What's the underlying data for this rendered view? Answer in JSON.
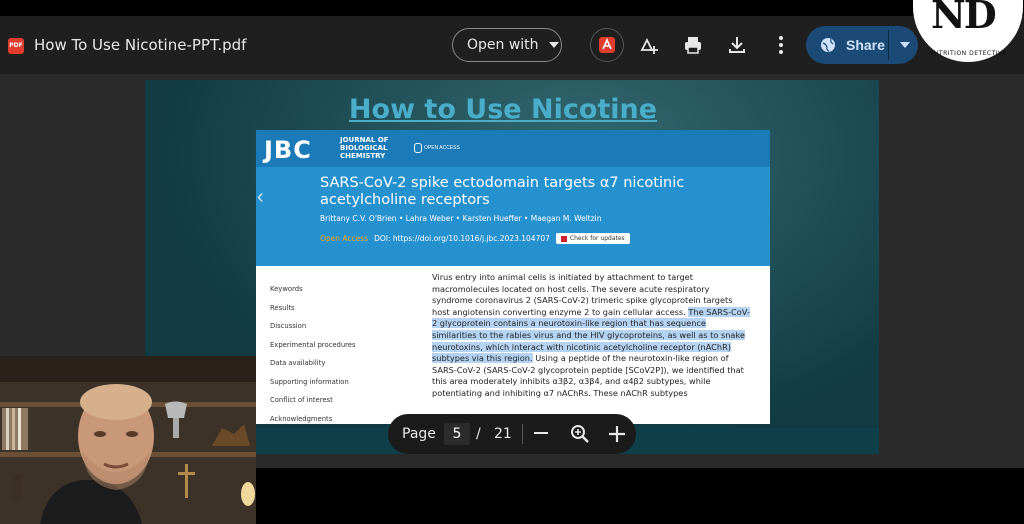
{
  "toolbar": {
    "pdf_badge": "PDF",
    "file_title": "How To Use Nicotine-PPT.pdf",
    "open_with": "Open with",
    "share": "Share"
  },
  "slide": {
    "title": "How to Use Nicotine",
    "journal": {
      "logo": "JBC",
      "name": "JOURNAL OF BIOLOGICAL CHEMISTRY",
      "open_badge": "OPEN ACCESS"
    },
    "article_title": "SARS-CoV-2 spike ectodomain targets α7 nicotinic acetylcholine receptors",
    "authors": "Brittany C.V. O'Brien • Lahra Weber • Karsten Hueffer • Maegan M. Weltzin",
    "open_access": "Open Access",
    "doi": "DOI: https://doi.org/10.1016/j.jbc.2023.104707",
    "check_updates": "Check for updates",
    "toc": [
      "Keywords",
      "Results",
      "Discussion",
      "Experimental procedures",
      "Data availability",
      "Supporting information",
      "Conflict of interest",
      "Acknowledgments"
    ],
    "abstract_pre": "Virus entry into animal cells is initiated by attachment to target macromolecules located on host cells. The severe acute respiratory syndrome coronavirus 2 (SARS-CoV-2) trimeric spike glycoprotein targets host angiotensin converting enzyme 2 to gain cellular access.",
    "abstract_hl": "The SARS-CoV-2 glycoprotein contains a neurotoxin-like region that has sequence similarities to the rabies virus and the HIV glycoproteins, as well as to snake neurotoxins, which interact with nicotinic acetylcholine receptor (nAChR) subtypes via this region.",
    "abstract_post": "Using a peptide of the neurotoxin-like region of SARS-CoV-2 (SARS-CoV-2 glycoprotein peptide [SCoV2P]), we identified that this area moderately inhibits α3β2, α3β4, and α4β2 subtypes, while potentiating and inhibiting α7 nAChRs. These nAChR subtypes"
  },
  "page_controls": {
    "page_label": "Page",
    "current_page": "5",
    "separator": "/",
    "total_pages": "21"
  },
  "brand": {
    "logo_text": "ND",
    "logo_sub": "NUTRITION DETECTIVE"
  },
  "colors": {
    "title_blue": "#4aaecb",
    "share_bg": "#1c4a76",
    "journal_blue": "#2591cf",
    "highlight": "#b5d4f4"
  },
  "icons": [
    "pdf-icon",
    "acrobat-icon",
    "add-to-drive-icon",
    "print-icon",
    "download-icon",
    "more-vert-icon",
    "globe-icon",
    "zoom-in-icon",
    "zoom-out-icon"
  ]
}
